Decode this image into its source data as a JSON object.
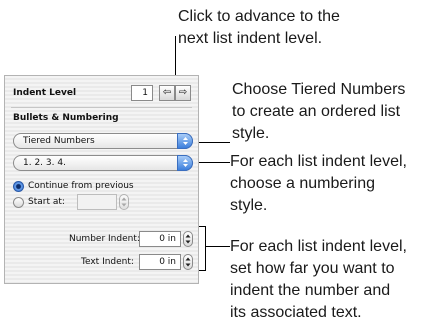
{
  "callouts": {
    "top": [
      "Click to advance to the",
      "next list indent level."
    ],
    "tiered": [
      "Choose Tiered Numbers",
      "to create an ordered list",
      "style."
    ],
    "numbering": [
      "For each list indent level,",
      "choose a numbering",
      "style."
    ],
    "indent": [
      "For each list indent level,",
      "set how far you want to",
      "indent the number and",
      "its associated text."
    ]
  },
  "panel": {
    "indent_level_label": "Indent Level",
    "indent_level_value": "1",
    "bullets_heading": "Bullets & Numbering",
    "style_popup": "Tiered Numbers",
    "format_popup": "1. 2. 3. 4.",
    "continue_label": "Continue from previous",
    "start_at_label": "Start at:",
    "start_at_value": "",
    "number_indent_label": "Number Indent:",
    "number_indent_value": "0 in",
    "text_indent_label": "Text Indent:",
    "text_indent_value": "0 in"
  },
  "icons": {
    "prev": "left-arrow-icon",
    "next": "right-arrow-icon",
    "popup": "up-down-chevron-icon",
    "stepper": "stepper-icon"
  }
}
